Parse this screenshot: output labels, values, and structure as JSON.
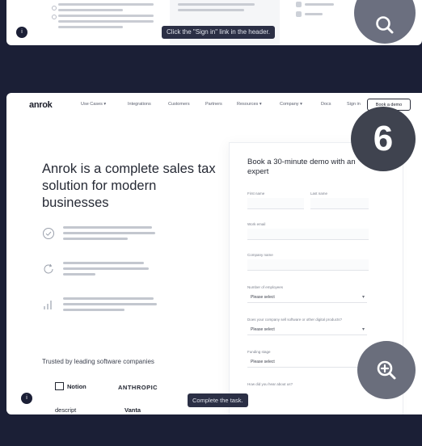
{
  "top_panel": {
    "tooltip": "Click the \"Sign in\" link in the header."
  },
  "nav": {
    "logo": "anrok",
    "items": [
      "Use Cases ▾",
      "Integrations",
      "Customers",
      "Partners",
      "Resources ▾",
      "Company ▾",
      "Docs",
      "Sign in"
    ],
    "cta": "Book a demo"
  },
  "hero": {
    "title": "Anrok is a complete sales tax solution for modern businesses",
    "trusted": "Trusted by leading software companies",
    "brands": [
      "Notion",
      "ANTHROPIC",
      "descript",
      "Vanta"
    ]
  },
  "form": {
    "title": "Book a 30-minute demo with an expert",
    "labels": {
      "first_name": "First name",
      "last_name": "Last name",
      "work_email": "Work email",
      "company_name": "Company name",
      "employees": "Number of employees",
      "digital_products": "Does your company sell software or other digital products?",
      "funding": "Funding stage",
      "how_heard": "How did you hear about us?"
    },
    "select_placeholder": "Please select"
  },
  "step_badge": "6",
  "bottom_tooltip": "Complete the task.",
  "colors": {
    "page_bg": "#1b1f36",
    "card_bg": "#ffffff",
    "badge_bg": "#3f434f",
    "zoom_bg": "#6a6e7c"
  },
  "icons": [
    "zoom-in-icon",
    "shield-check-icon",
    "refresh-icon",
    "bar-chart-icon"
  ]
}
